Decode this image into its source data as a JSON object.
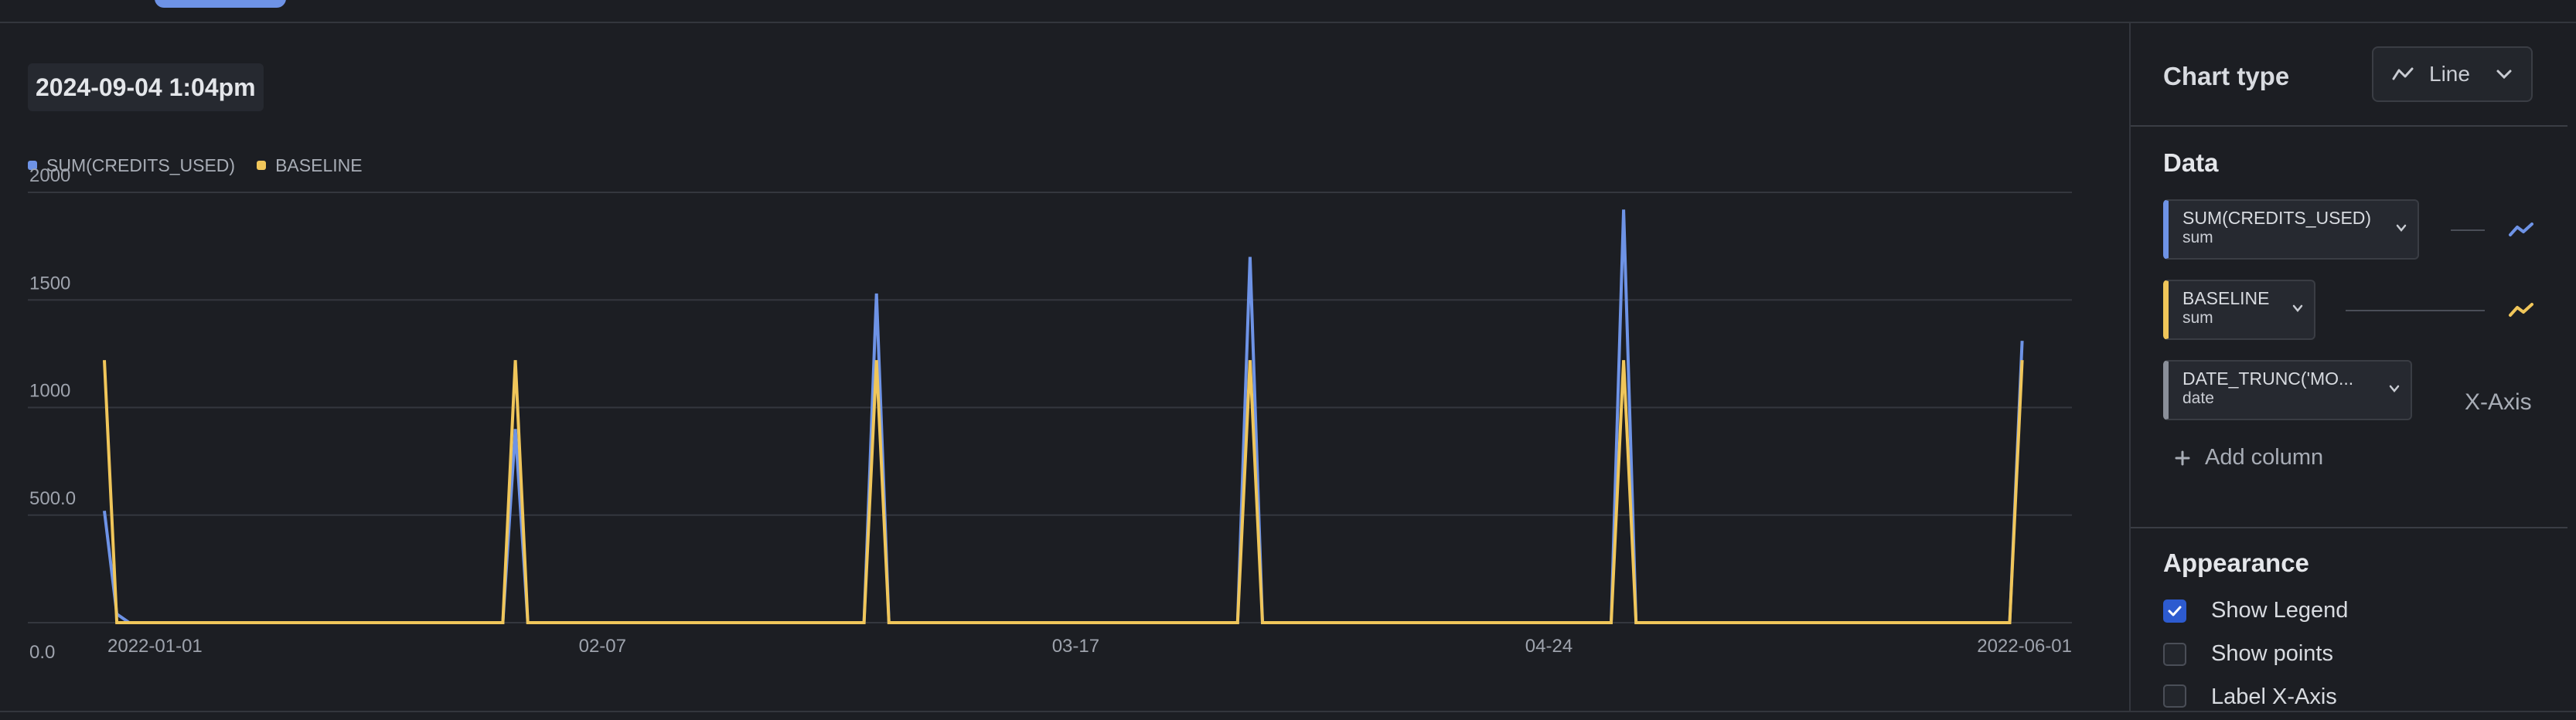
{
  "header": {
    "timestamp": "2024-09-04 1:04pm"
  },
  "legend": [
    {
      "label": "SUM(CREDITS_USED)",
      "color": "#6e93e6"
    },
    {
      "label": "BASELINE",
      "color": "#f0c65a"
    }
  ],
  "chart_data": {
    "type": "line",
    "grid": true,
    "legend_position": "top-left",
    "ylim": [
      0,
      2000
    ],
    "y_ticks": [
      "0.0",
      "500.0",
      "1000",
      "1500",
      "2000"
    ],
    "x_ticks": [
      "2022-01-01",
      "02-07",
      "03-17",
      "04-24",
      "2022-06-01"
    ],
    "xlim": [
      "2021-12-29",
      "2022-06-05"
    ],
    "series": [
      {
        "name": "SUM(CREDITS_USED)",
        "color": "#6e93e6",
        "points": [
          [
            "2021-12-29",
            520
          ],
          [
            "2021-12-30",
            40
          ],
          [
            "2021-12-31",
            0
          ],
          [
            "2022-01-30",
            0
          ],
          [
            "2022-01-31",
            900
          ],
          [
            "2022-02-01",
            0
          ],
          [
            "2022-02-28",
            0
          ],
          [
            "2022-03-01",
            1530
          ],
          [
            "2022-03-02",
            0
          ],
          [
            "2022-03-30",
            0
          ],
          [
            "2022-03-31",
            1700
          ],
          [
            "2022-04-01",
            0
          ],
          [
            "2022-04-29",
            0
          ],
          [
            "2022-04-30",
            1920
          ],
          [
            "2022-05-01",
            0
          ],
          [
            "2022-05-31",
            0
          ],
          [
            "2022-06-01",
            1310
          ]
        ]
      },
      {
        "name": "BASELINE",
        "color": "#f0c65a",
        "points": [
          [
            "2021-12-29",
            1220
          ],
          [
            "2021-12-30",
            0
          ],
          [
            "2022-01-30",
            0
          ],
          [
            "2022-01-31",
            1220
          ],
          [
            "2022-02-01",
            0
          ],
          [
            "2022-02-28",
            0
          ],
          [
            "2022-03-01",
            1220
          ],
          [
            "2022-03-02",
            0
          ],
          [
            "2022-03-30",
            0
          ],
          [
            "2022-03-31",
            1220
          ],
          [
            "2022-04-01",
            0
          ],
          [
            "2022-04-29",
            0
          ],
          [
            "2022-04-30",
            1220
          ],
          [
            "2022-05-01",
            0
          ],
          [
            "2022-05-31",
            0
          ],
          [
            "2022-06-01",
            1220
          ]
        ]
      }
    ]
  },
  "panel": {
    "chart_type_heading": "Chart type",
    "chart_type_value": "Line",
    "data_heading": "Data",
    "columns": [
      {
        "name": "SUM(CREDITS_USED)",
        "agg": "sum",
        "color": "#6e93e6"
      },
      {
        "name": "BASELINE",
        "agg": "sum",
        "color": "#f0c65a"
      },
      {
        "name": "DATE_TRUNC('MO...",
        "agg": "date",
        "color": "#8a8f99",
        "role": "X-Axis"
      }
    ],
    "add_column": "Add column",
    "appearance_heading": "Appearance",
    "options": [
      {
        "label": "Show Legend",
        "checked": true
      },
      {
        "label": "Show points",
        "checked": false
      },
      {
        "label": "Label X-Axis",
        "checked": false
      }
    ]
  }
}
